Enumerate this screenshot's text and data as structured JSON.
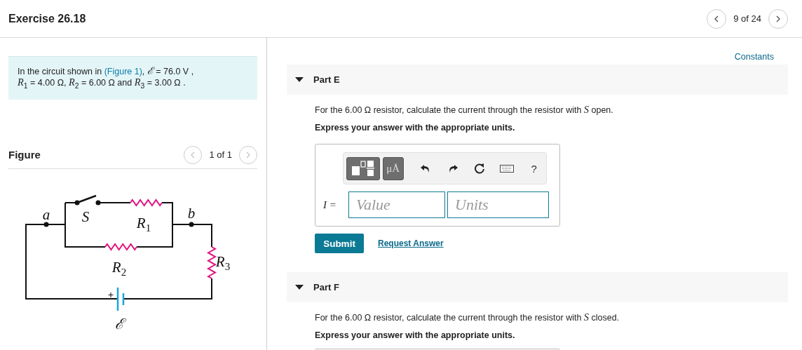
{
  "header": {
    "title": "Exercise 26.18",
    "pager": {
      "label": "9 of 24",
      "prev": {
        "disabled": false
      },
      "next": {
        "disabled": false
      }
    }
  },
  "intro": {
    "before": "In the circuit shown in ",
    "link": "(Figure 1)",
    "after": ", *ℰ* = 76.0 V ,",
    "line_2": "*R*$_{1}$ = 4.00 Ω, *R*$_{2}$ = 6.00 Ω and *R*$_{3}$ = 3.00 Ω ."
  },
  "figure": {
    "title": "Figure",
    "pager": {
      "label": "1 of 1",
      "prev": {
        "disabled": true
      },
      "next": {
        "disabled": true
      }
    },
    "labels": [
      {
        "text": "a"
      },
      {
        "text": "S"
      },
      {
        "text": "R",
        "sub": "1"
      },
      {
        "text": "b"
      },
      {
        "text": "R",
        "sub": "2"
      },
      {
        "text": "R",
        "sub": "3"
      },
      {
        "text": "+"
      },
      {
        "text": "ℰ"
      }
    ]
  },
  "constants_link": "Constants",
  "parts": [
    {
      "title": "Part E",
      "expanded": true,
      "question": "For the 6.00 Ω resistor, calculate the current through the resistor with *S* open.",
      "instruction": "Express your answer with the appropriate units.",
      "answer": {
        "units_button": "μÅ",
        "help": "?",
        "variable": "I =",
        "value_placeholder": "Value",
        "units_placeholder": "Units",
        "submit": "Submit",
        "request": "Request Answer"
      }
    },
    {
      "title": "Part F",
      "expanded": true,
      "question": "For the 6.00 Ω resistor, calculate the current through the resistor with *S* closed.",
      "instruction": "Express your answer with the appropriate units."
    }
  ]
}
